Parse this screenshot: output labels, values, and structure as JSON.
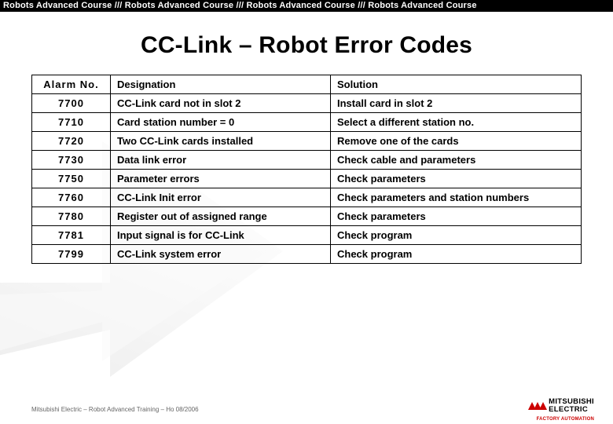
{
  "header": {
    "text": "Robots Advanced Course /// Robots Advanced Course /// Robots Advanced Course /// Robots Advanced Course"
  },
  "title": "CC-Link – Robot Error Codes",
  "table": {
    "headers": {
      "c1": "Alarm No.",
      "c2": "Designation",
      "c3": "Solution"
    },
    "rows": [
      {
        "alarm": "7700",
        "designation": "CC-Link card not in slot 2",
        "solution": "Install card in slot 2"
      },
      {
        "alarm": "7710",
        "designation": "Card station number = 0",
        "solution": "Select a different station no."
      },
      {
        "alarm": "7720",
        "designation": "Two CC-Link cards installed",
        "solution": "Remove one of the cards"
      },
      {
        "alarm": "7730",
        "designation": "Data link error",
        "solution": "Check cable and parameters"
      },
      {
        "alarm": "7750",
        "designation": "Parameter errors",
        "solution": "Check parameters"
      },
      {
        "alarm": "7760",
        "designation": "CC-Link Init error",
        "solution": "Check parameters and station numbers"
      },
      {
        "alarm": "7780",
        "designation": "Register out of assigned range",
        "solution": "Check parameters"
      },
      {
        "alarm": "7781",
        "designation": "Input signal is for CC-Link",
        "solution": "Check program"
      },
      {
        "alarm": "7799",
        "designation": "CC-Link system error",
        "solution": "Check program"
      }
    ]
  },
  "footer": "Mitsubishi Electric – Robot Advanced Training – Ho 08/2006",
  "logo": {
    "line1": "MITSUBISHI",
    "line2": "ELECTRIC",
    "sub": "FACTORY AUTOMATION"
  }
}
